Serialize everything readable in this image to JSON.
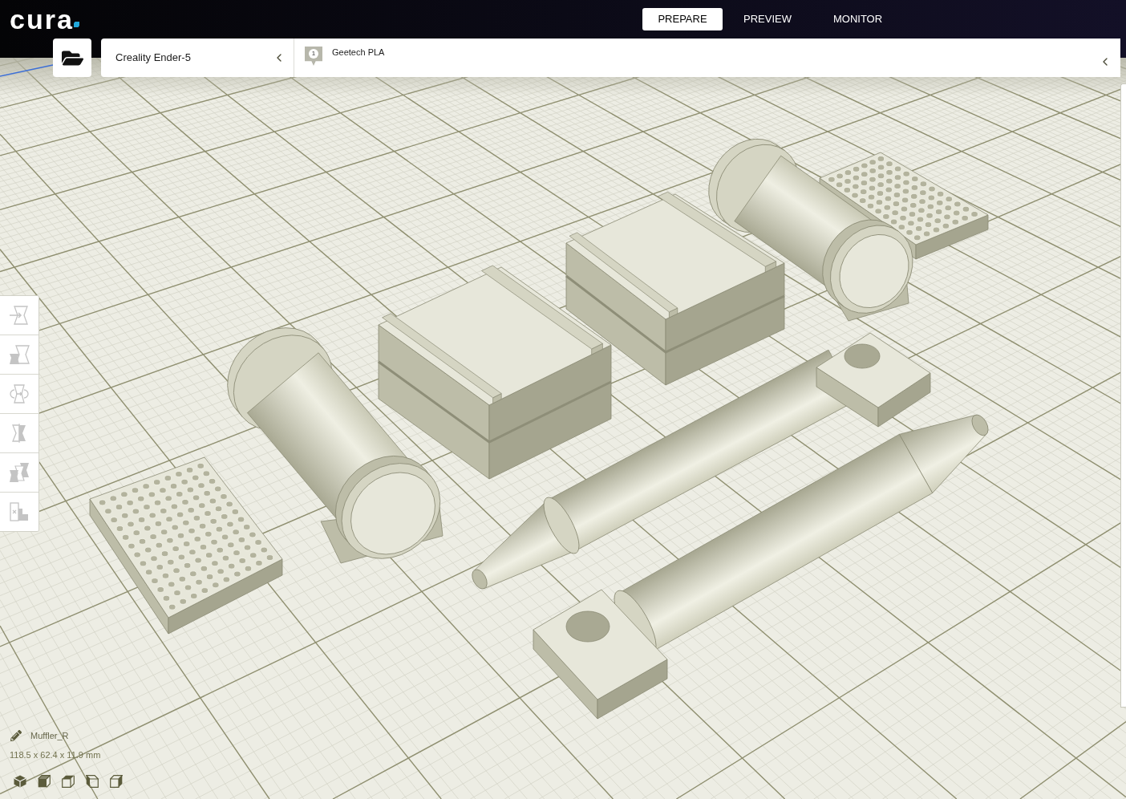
{
  "header": {
    "logo": "cura",
    "tabs": [
      {
        "label": "PREPARE",
        "selected": true
      },
      {
        "label": "PREVIEW",
        "selected": false
      },
      {
        "label": "MONITOR",
        "selected": false
      }
    ]
  },
  "printer_selector": {
    "name": "Creality Ender-5"
  },
  "print_setup": {
    "extruder": "1",
    "material": "Geetech PLA"
  },
  "tools": [
    {
      "kind": "move"
    },
    {
      "kind": "scale"
    },
    {
      "kind": "rotate"
    },
    {
      "kind": "mirror"
    },
    {
      "kind": "per_model_settings"
    },
    {
      "kind": "support_blocker"
    }
  ],
  "selected_object": {
    "name": "Muffler_R",
    "dimensions": "118.5 x 62.4 x 11.9 mm"
  },
  "view_buttons": [
    {
      "kind": "perspective"
    },
    {
      "kind": "front"
    },
    {
      "kind": "top"
    },
    {
      "kind": "left"
    },
    {
      "kind": "right"
    }
  ]
}
